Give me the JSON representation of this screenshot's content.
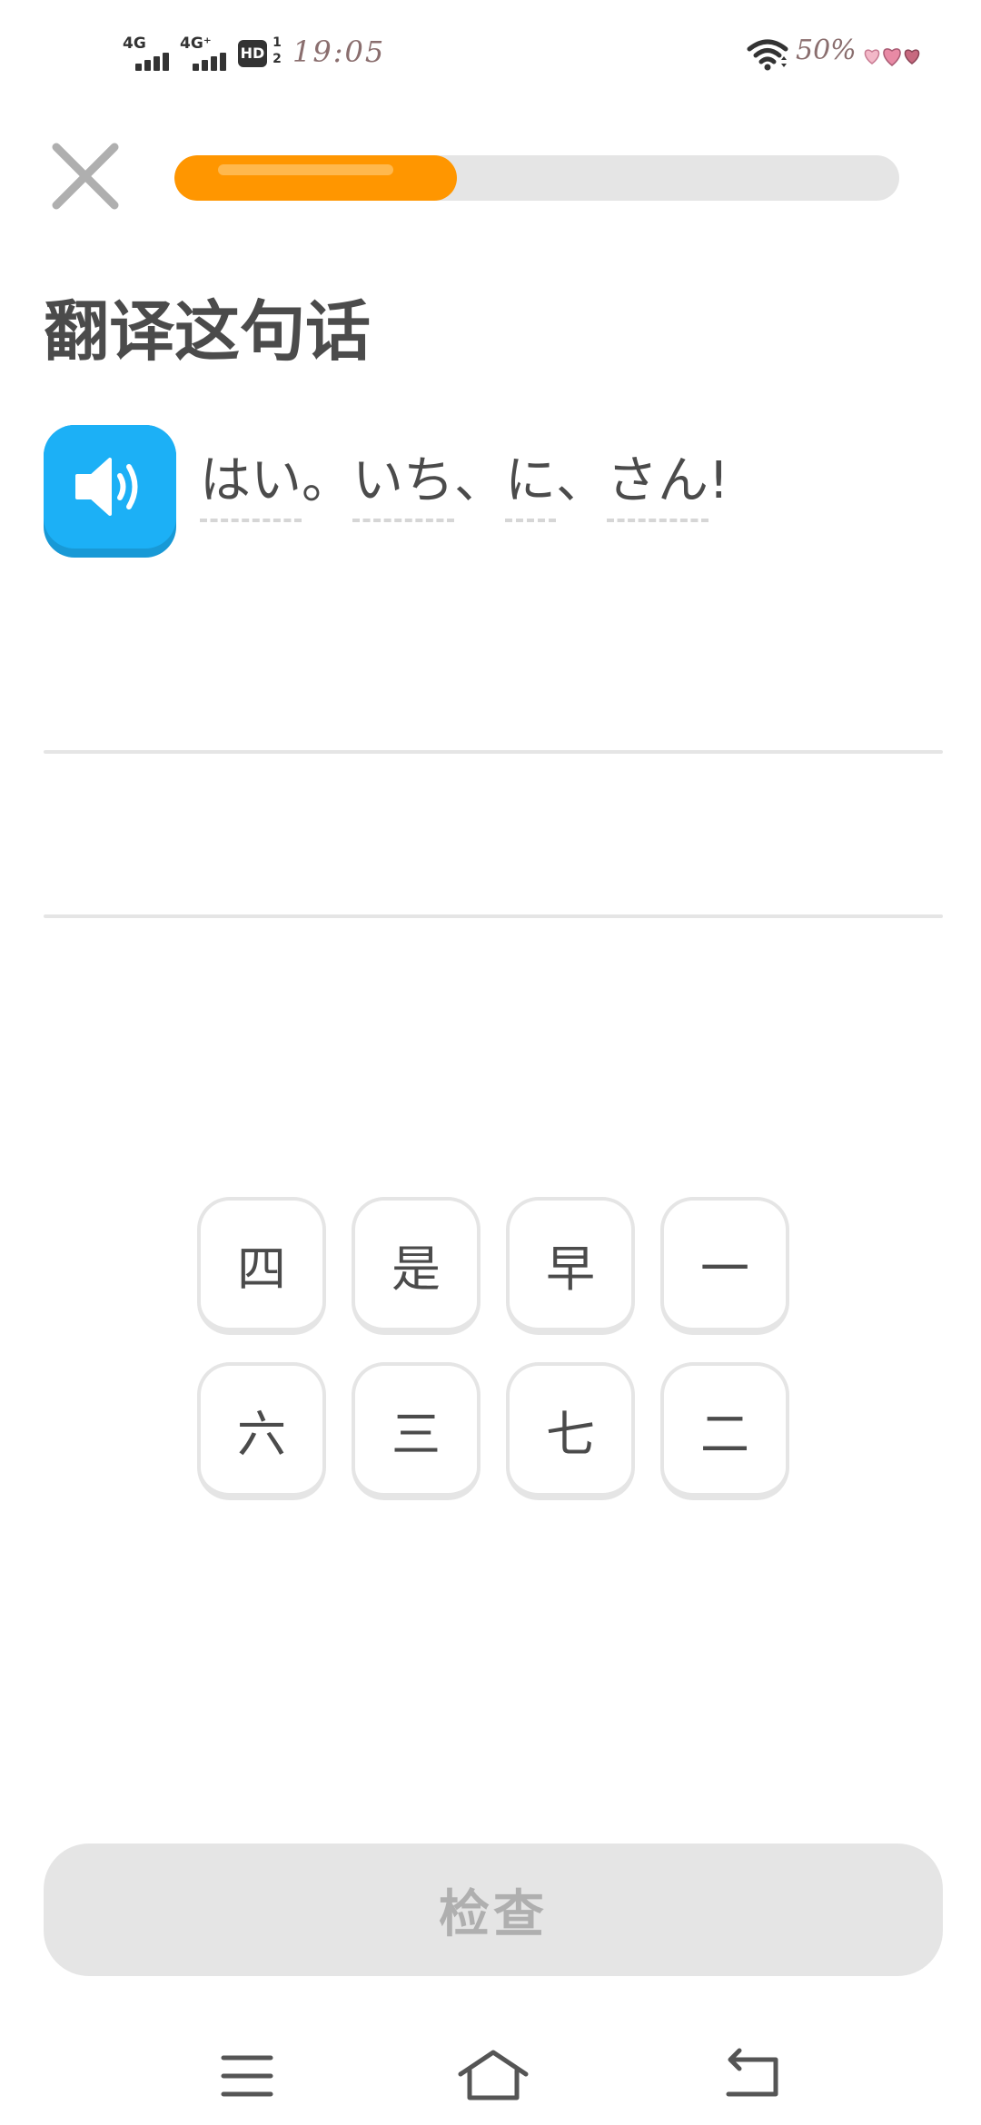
{
  "status_bar": {
    "network_1": "4G",
    "network_2": "4G⁺",
    "hd_label": "HD",
    "hd_sim_1": "1",
    "hd_sim_2": "2",
    "time": "19:05",
    "battery": "50%",
    "icons": [
      "signal-icon",
      "signal-icon",
      "hd-voice-icon",
      "wifi-icon",
      "hearts-icon"
    ]
  },
  "lesson": {
    "progress": 0.39,
    "accent_color": "#ff9600",
    "title": "翻译这句话",
    "sentence": [
      {
        "text": "はい",
        "kind": "word"
      },
      {
        "text": "。",
        "kind": "punct"
      },
      {
        "text": "いち",
        "kind": "word"
      },
      {
        "text": "、",
        "kind": "punct"
      },
      {
        "text": "に",
        "kind": "word"
      },
      {
        "text": "、",
        "kind": "punct"
      },
      {
        "text": "さん",
        "kind": "word"
      },
      {
        "text": "!",
        "kind": "punct"
      }
    ],
    "speaker_color": "#1cb0f6"
  },
  "word_bank": {
    "rows": [
      [
        "四",
        "是",
        "早",
        "一"
      ],
      [
        "六",
        "三",
        "七",
        "二"
      ]
    ]
  },
  "actions": {
    "check_label": "检查",
    "check_enabled": false
  },
  "nav_bar": {
    "icons": [
      "menu-icon",
      "home-icon",
      "back-icon"
    ]
  }
}
